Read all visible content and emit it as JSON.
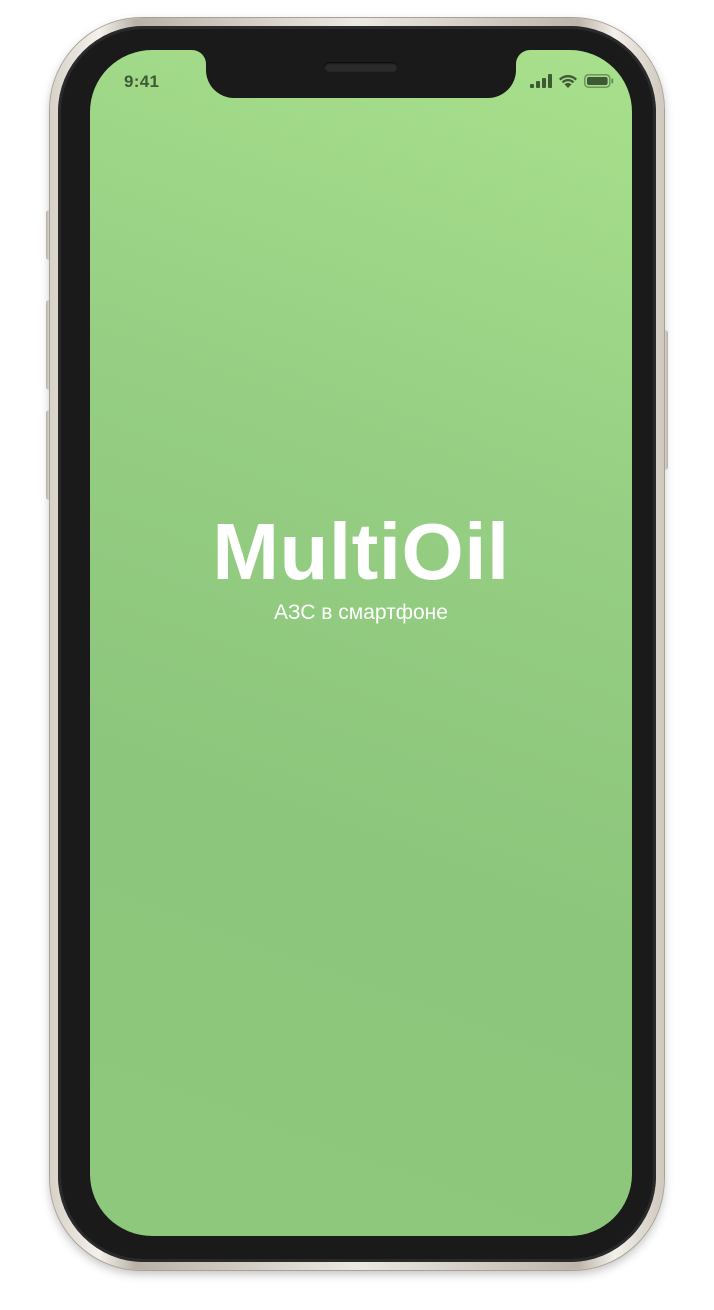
{
  "status_bar": {
    "time": "9:41",
    "signal_icon": "cellular-signal-icon",
    "wifi_icon": "wifi-icon",
    "battery_icon": "battery-icon",
    "text_color": "#3d5a35"
  },
  "splash": {
    "app_name": "MultiOil",
    "tagline": "АЗС в смартфоне",
    "background_top": "#a8e08c",
    "background_bottom": "#8dc87c",
    "text_color": "#ffffff"
  }
}
